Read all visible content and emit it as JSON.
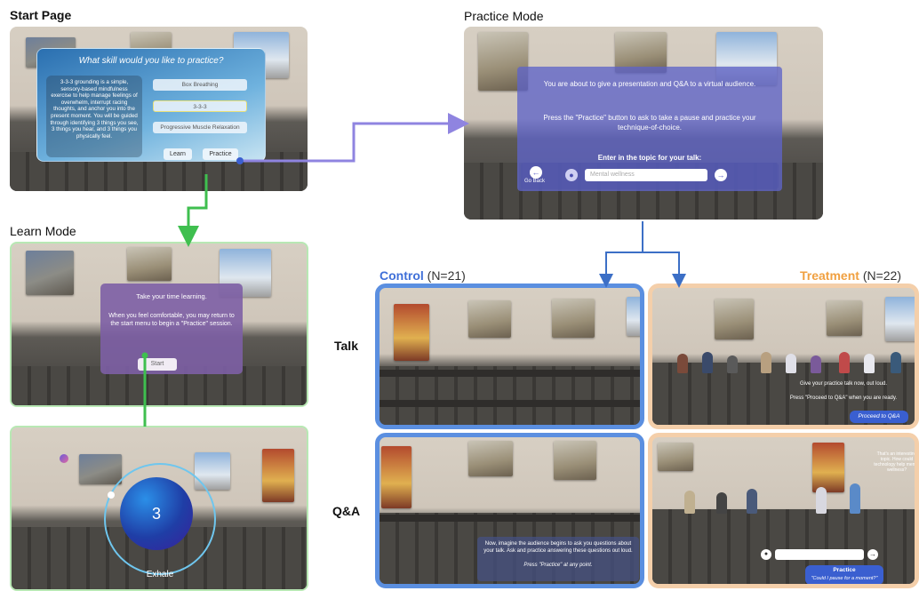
{
  "headings": {
    "start_page": "Start Page",
    "practice_mode": "Practice Mode",
    "learn_mode": "Learn Mode"
  },
  "start_page": {
    "question": "What skill would you like to practice?",
    "description": "3-3-3 grounding is a simple, sensory-based mindfulness exercise to help manage feelings of overwhelm, interrupt racing thoughts, and anchor you into the present moment. You will be guided through identifying 3 things you see, 3 things you hear, and 3 things you physically feel.",
    "options": [
      "Box Breathing",
      "3-3-3",
      "Progressive Muscle Relaxation"
    ],
    "learn_button": "Learn",
    "practice_button": "Practice"
  },
  "practice_mode": {
    "line1": "You are about to give a presentation and Q&A to a virtual audience.",
    "line2": "Press the \"Practice\" button to ask to take a pause and practice your technique-of-choice.",
    "prompt": "Enter in the topic for your talk:",
    "placeholder": "Mental wellness",
    "go_back": "Go Back"
  },
  "learn_mode": {
    "line1": "Take your time learning.",
    "line2": "When you feel comfortable, you may return to the start menu to begin a \"Practice\" session.",
    "start_button": "Start",
    "count": "3",
    "phase": "Exhale"
  },
  "groups": {
    "control_name": "Control",
    "control_n": "(N=21)",
    "treatment_name": "Treatment",
    "treatment_n": "(N=22)"
  },
  "row_labels": {
    "talk": "Talk",
    "qa": "Q&A"
  },
  "treatment_talk": {
    "line1": "Give your practice talk now, out loud.",
    "line2": "Press \"Proceed to Q&A\" when you are ready.",
    "button": "Proceed to Q&A"
  },
  "control_qa": {
    "line1": "Now, imagine the audience begins to ask you questions about your talk. Ask and practice answering these questions out loud.",
    "line2": "Press \"Practice\" at any point."
  },
  "treatment_qa": {
    "speech": "That's an interesting topic. How could technology help mental wellness?",
    "button_title": "Practice",
    "button_sub": "\"Could I pause for a moment?\""
  },
  "colors": {
    "green_arrow": "#3fbf4f",
    "purple_arrow": "#8f84e0",
    "blue_arrow": "#3c6fc6",
    "control_blue": "#3f6fd8",
    "treatment_orange": "#f0a040"
  }
}
